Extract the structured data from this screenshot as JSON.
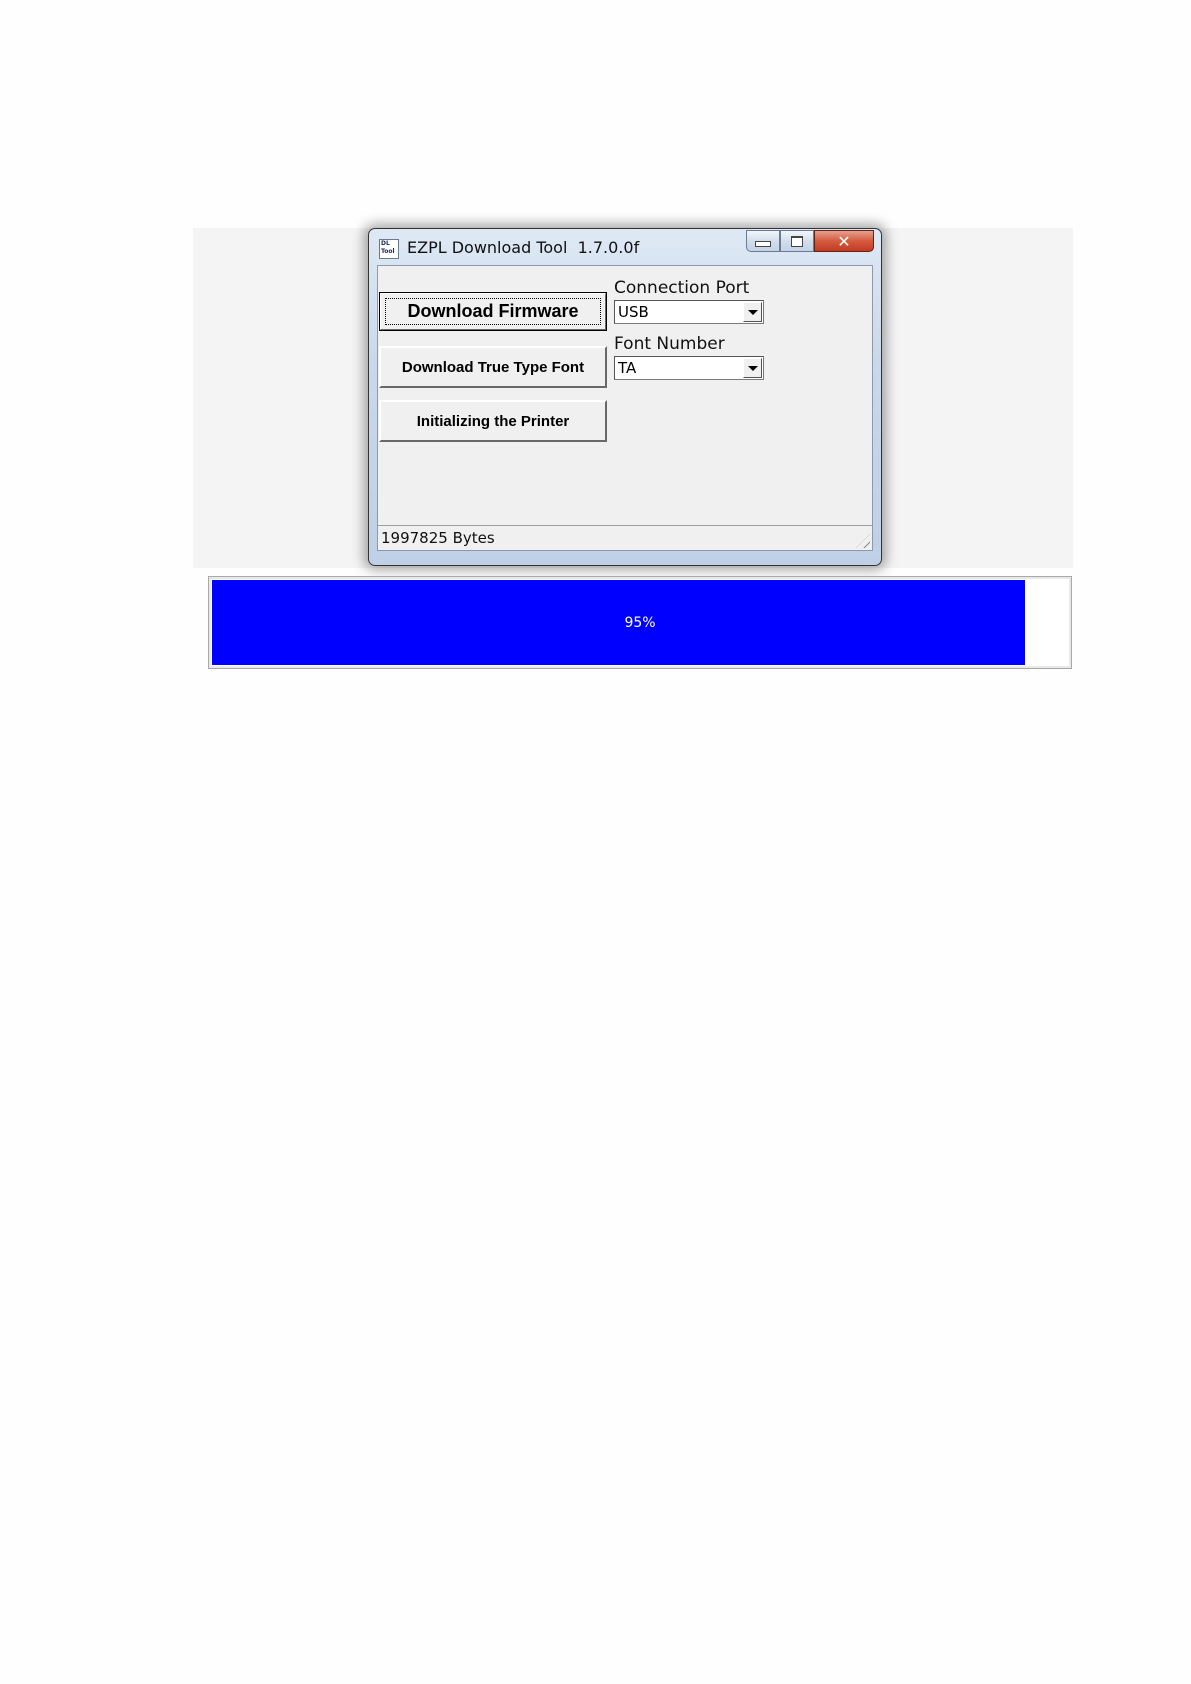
{
  "window": {
    "title": "EZPL Download Tool  1.7.0.0f",
    "icon_label": "DL Tool",
    "icon": "app-icon",
    "caption_icons": [
      "minimize-icon",
      "maximize-icon",
      "close-icon"
    ]
  },
  "buttons": {
    "download_firmware": "Download Firmware",
    "download_ttf": "Download True Type Font",
    "init_printer": "Initializing the Printer"
  },
  "connection_port": {
    "label": "Connection Port",
    "value": "USB"
  },
  "font_number": {
    "label": "Font Number",
    "value": "TA"
  },
  "status": {
    "text": "1997825 Bytes"
  },
  "progress": {
    "label": "95%",
    "fraction": 0.95,
    "color": "#0000ff"
  }
}
